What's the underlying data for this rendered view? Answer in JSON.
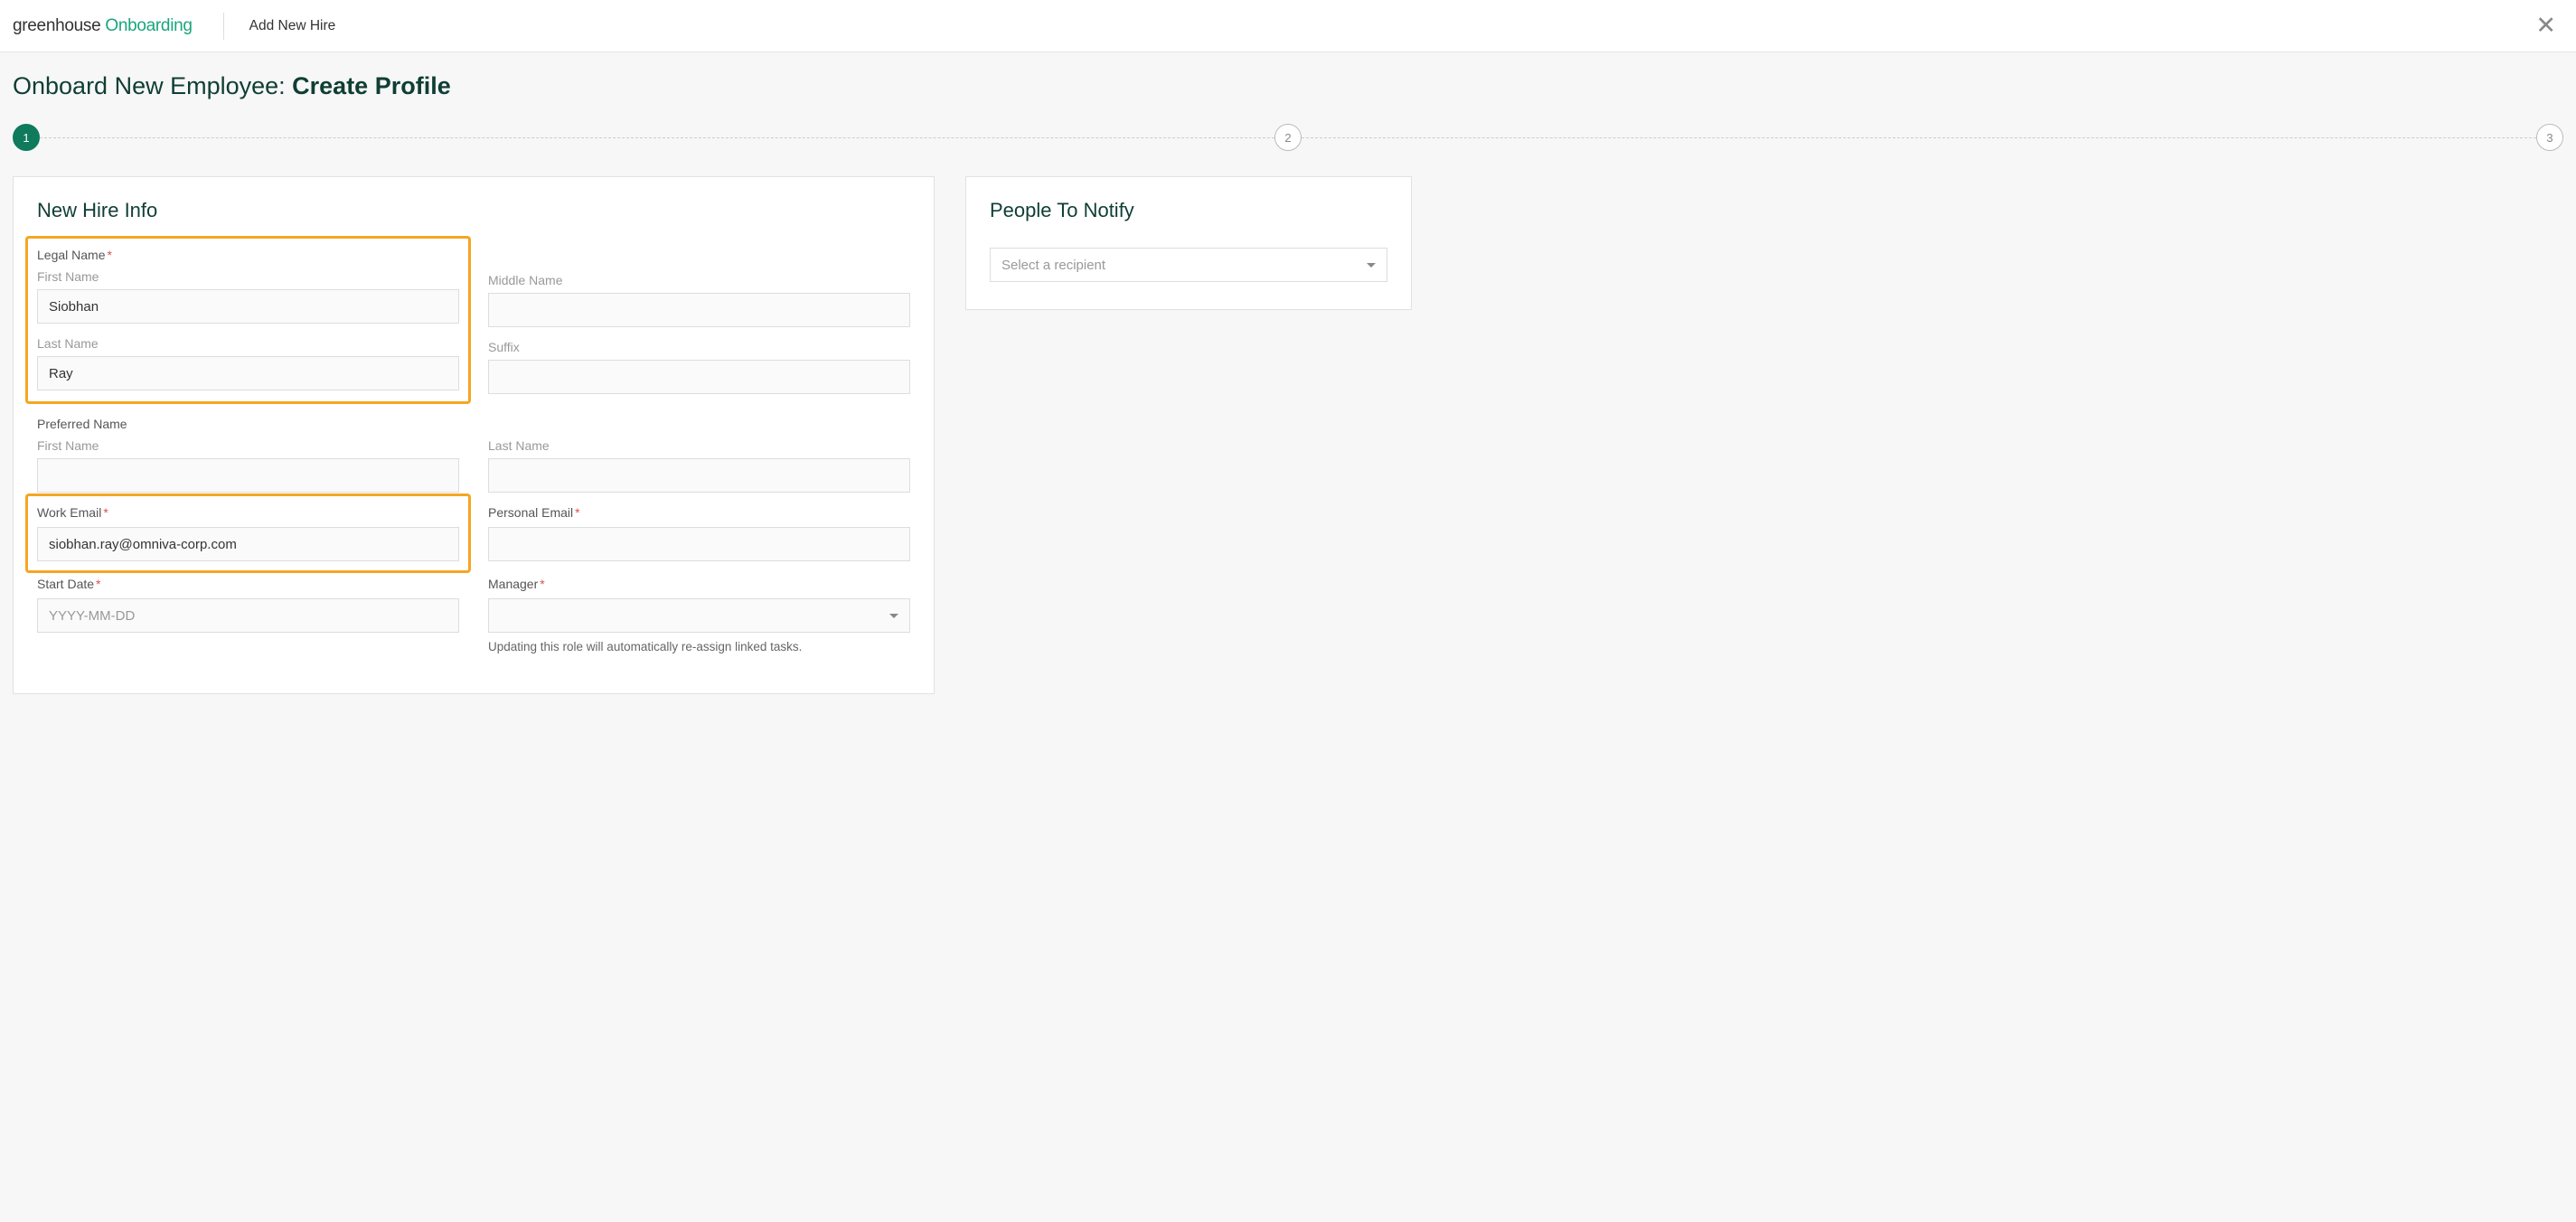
{
  "header": {
    "logo_part1": "greenhouse",
    "logo_part2": "Onboarding",
    "page_label": "Add New Hire"
  },
  "title": {
    "prefix": "Onboard New Employee: ",
    "main": "Create Profile"
  },
  "stepper": {
    "s1": "1",
    "s2": "2",
    "s3": "3"
  },
  "form": {
    "card_title": "New Hire Info",
    "legal_name_label": "Legal Name",
    "first_name_label": "First Name",
    "middle_name_label": "Middle Name",
    "last_name_label": "Last Name",
    "suffix_label": "Suffix",
    "preferred_name_label": "Preferred Name",
    "pref_first_label": "First Name",
    "pref_last_label": "Last Name",
    "work_email_label": "Work Email",
    "personal_email_label": "Personal Email",
    "start_date_label": "Start Date",
    "start_date_placeholder": "YYYY-MM-DD",
    "manager_label": "Manager",
    "manager_helper": "Updating this role will automatically re-assign linked tasks.",
    "values": {
      "first_name": "Siobhan",
      "last_name": "Ray",
      "work_email": "siobhan.ray@omniva-corp.com"
    }
  },
  "side": {
    "title": "People To Notify",
    "select_placeholder": "Select a recipient"
  }
}
